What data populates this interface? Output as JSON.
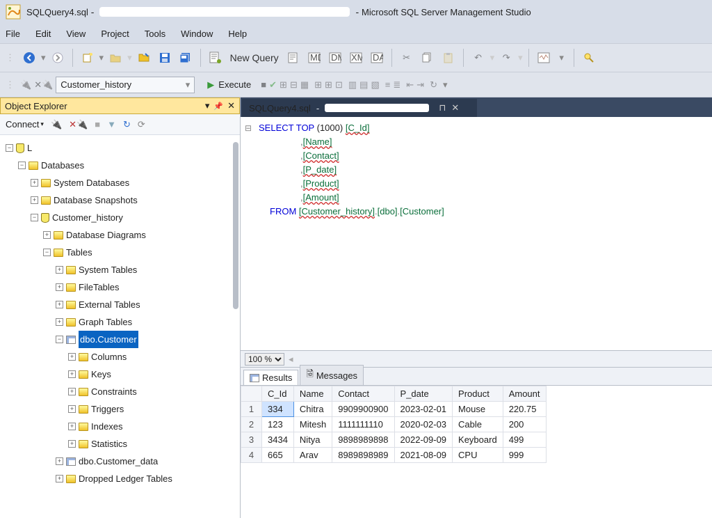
{
  "title": {
    "file": "SQLQuery4.sql",
    "app": "Microsoft SQL Server Management Studio"
  },
  "menu": [
    "File",
    "Edit",
    "View",
    "Project",
    "Tools",
    "Window",
    "Help"
  ],
  "toolbar": {
    "new_query": "New Query"
  },
  "toolbar2": {
    "db_combo": "Customer_history",
    "execute": "Execute"
  },
  "object_explorer": {
    "title": "Object Explorer",
    "connect": "Connect",
    "tree": {
      "root": "L",
      "databases": "Databases",
      "sysdb": "System Databases",
      "snap": "Database Snapshots",
      "custhist": "Customer_history",
      "dbdiag": "Database Diagrams",
      "tables": "Tables",
      "systables": "System Tables",
      "filetables": "FileTables",
      "exttables": "External Tables",
      "graphtables": "Graph Tables",
      "dbocust": "dbo.Customer",
      "columns": "Columns",
      "keys": "Keys",
      "constraints": "Constraints",
      "triggers": "Triggers",
      "indexes": "Indexes",
      "statistics": "Statistics",
      "dbocustdata": "dbo.Customer_data",
      "dropped": "Dropped Ledger Tables"
    }
  },
  "editor": {
    "tab": "SQLQuery4.sql",
    "sql": {
      "l1a": "SELECT",
      "l1b": "TOP",
      "l1c": "(1000)",
      "l1d": "[C_Id]",
      "l2": "[Name]",
      "l3": "[Contact]",
      "l4": "[P_date]",
      "l5": "[Product]",
      "l6": "[Amount]",
      "l7a": "FROM",
      "l7b": "[Customer_history]",
      "l7c": "[dbo]",
      "l7d": "[Customer]",
      "comma": ",",
      "dot": "."
    },
    "zoom": "100 %"
  },
  "results": {
    "tab_results": "Results",
    "tab_messages": "Messages",
    "headers": [
      "C_Id",
      "Name",
      "Contact",
      "P_date",
      "Product",
      "Amount"
    ],
    "rows": [
      {
        "n": "1",
        "c": [
          "334",
          "Chitra",
          "9909900900",
          "2023-02-01",
          "Mouse",
          "220.75"
        ]
      },
      {
        "n": "2",
        "c": [
          "123",
          "Mitesh",
          "1111111110",
          "2020-02-03",
          "Cable",
          "200"
        ]
      },
      {
        "n": "3",
        "c": [
          "3434",
          "Nitya",
          "9898989898",
          "2022-09-09",
          "Keyboard",
          "499"
        ]
      },
      {
        "n": "4",
        "c": [
          "665",
          "Arav",
          "8989898989",
          "2021-08-09",
          "CPU",
          "999"
        ]
      }
    ]
  }
}
